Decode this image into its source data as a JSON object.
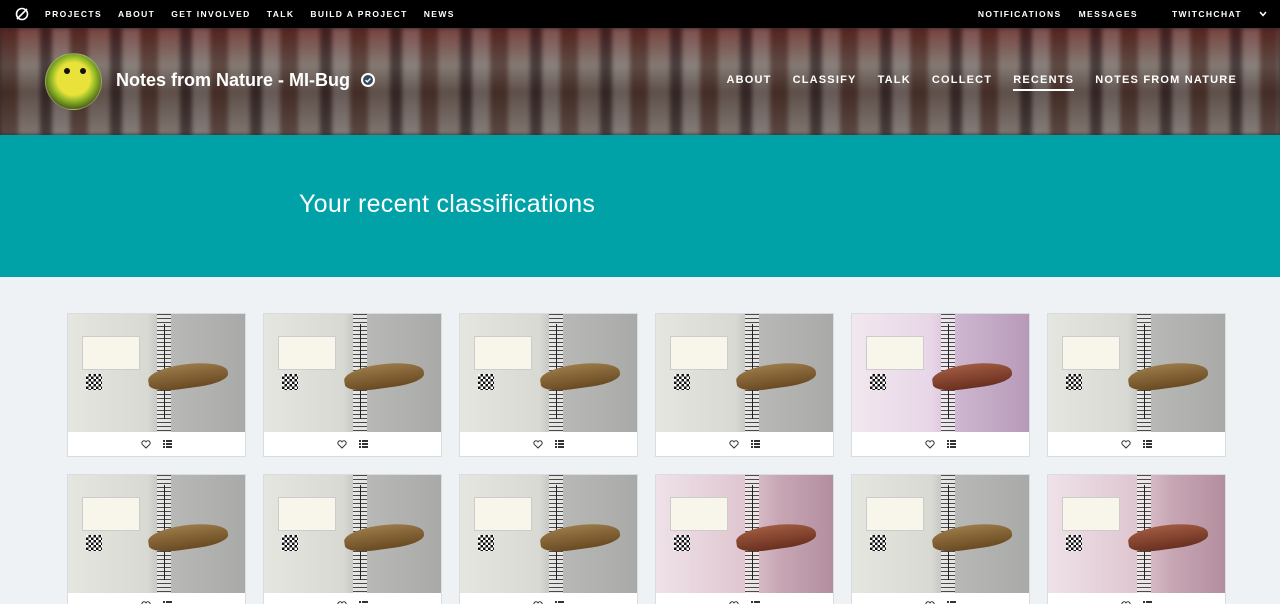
{
  "topbar": {
    "nav_left": [
      "PROJECTS",
      "ABOUT",
      "GET INVOLVED",
      "TALK",
      "BUILD A PROJECT",
      "NEWS"
    ],
    "nav_right": [
      "NOTIFICATIONS",
      "MESSAGES",
      "TWITCHCHAT"
    ]
  },
  "project": {
    "title": "Notes from Nature - MI-Bug",
    "nav": [
      "ABOUT",
      "CLASSIFY",
      "TALK",
      "COLLECT",
      "RECENTS",
      "NOTES FROM NATURE"
    ],
    "active_nav": "RECENTS"
  },
  "banner": {
    "heading": "Your recent classifications"
  },
  "colors": {
    "banner": "#00a2a8",
    "topbar": "#000000",
    "page_bg": "#eff2f5"
  },
  "cards": [
    {
      "tone": "grey",
      "bug": "brown"
    },
    {
      "tone": "grey",
      "bug": "brown"
    },
    {
      "tone": "grey",
      "bug": "brown"
    },
    {
      "tone": "grey",
      "bug": "brown"
    },
    {
      "tone": "lilac",
      "bug": "red"
    },
    {
      "tone": "grey",
      "bug": "brown"
    },
    {
      "tone": "grey",
      "bug": "brown"
    },
    {
      "tone": "grey",
      "bug": "brown"
    },
    {
      "tone": "grey",
      "bug": "brown"
    },
    {
      "tone": "pink",
      "bug": "red"
    },
    {
      "tone": "grey",
      "bug": "brown"
    },
    {
      "tone": "pink",
      "bug": "red"
    }
  ],
  "card_icons": [
    "heart-icon",
    "list-icon"
  ]
}
